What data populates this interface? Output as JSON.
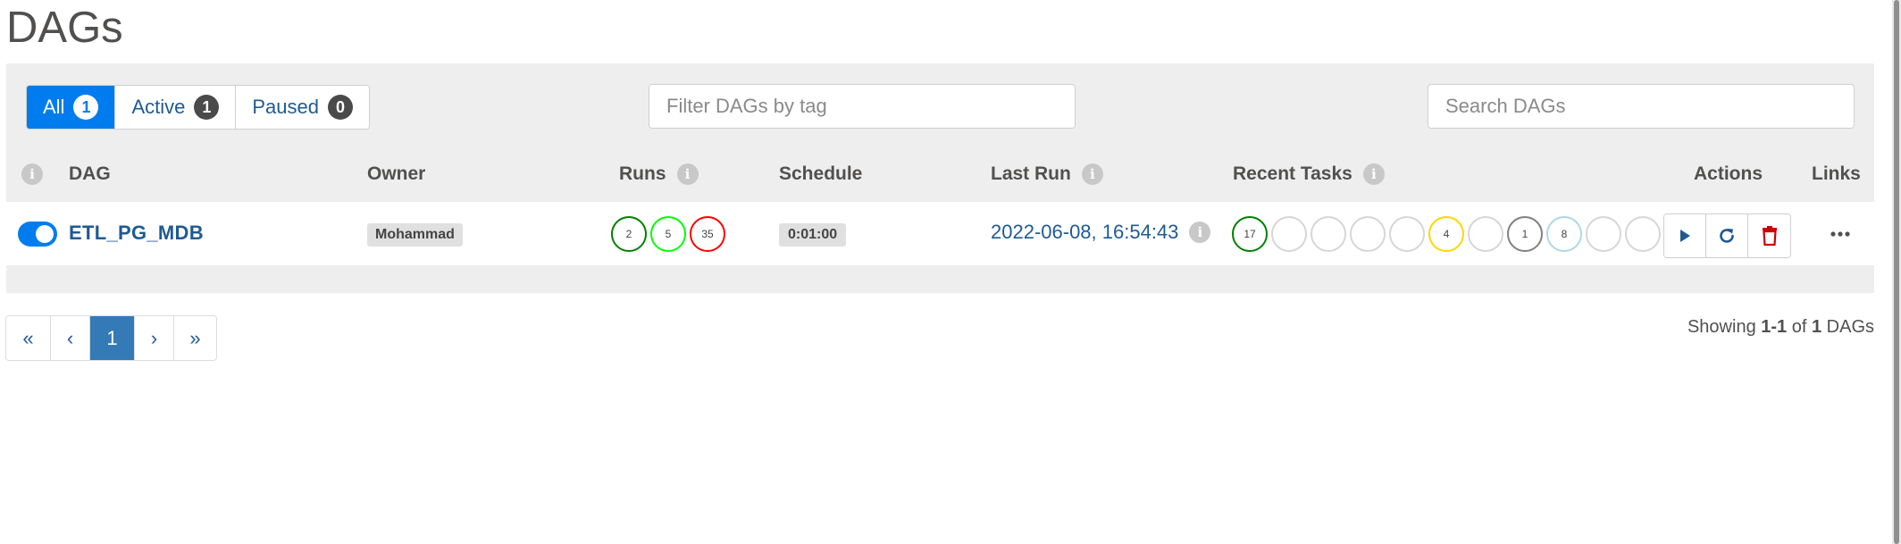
{
  "page": {
    "title": "DAGs"
  },
  "filters": {
    "tabs": [
      {
        "label": "All",
        "count": "1",
        "active": true
      },
      {
        "label": "Active",
        "count": "1",
        "active": false
      },
      {
        "label": "Paused",
        "count": "0",
        "active": false
      }
    ],
    "tag_placeholder": "Filter DAGs by tag",
    "search_placeholder": "Search DAGs"
  },
  "table": {
    "headers": {
      "dag": "DAG",
      "owner": "Owner",
      "runs": "Runs",
      "schedule": "Schedule",
      "last_run": "Last Run",
      "recent_tasks": "Recent Tasks",
      "actions": "Actions",
      "links": "Links"
    },
    "info_icon": "i",
    "rows": [
      {
        "enabled": true,
        "dag_id": "ETL_PG_MDB",
        "owner": "Mohammad",
        "runs": [
          {
            "state": "success",
            "count": "2",
            "color": "#008000"
          },
          {
            "state": "running",
            "count": "5",
            "color": "#00ff00"
          },
          {
            "state": "failed",
            "count": "35",
            "color": "#ff0000"
          }
        ],
        "schedule": "0:01:00",
        "last_run": "2022-06-08, 16:54:43",
        "recent_tasks": [
          {
            "count": "17",
            "color": "#008000"
          },
          {
            "count": "",
            "color": "#d6d6d6"
          },
          {
            "count": "",
            "color": "#d6d6d6"
          },
          {
            "count": "",
            "color": "#d6d6d6"
          },
          {
            "count": "",
            "color": "#d6d6d6"
          },
          {
            "count": "4",
            "color": "#ffd700"
          },
          {
            "count": "",
            "color": "#d6d6d6"
          },
          {
            "count": "1",
            "color": "#808080"
          },
          {
            "count": "8",
            "color": "#add8e6"
          },
          {
            "count": "",
            "color": "#d6d6d6"
          },
          {
            "count": "",
            "color": "#d6d6d6"
          }
        ],
        "actions": [
          {
            "name": "trigger-dag-button",
            "icon": "play-icon"
          },
          {
            "name": "refresh-dag-button",
            "icon": "refresh-icon"
          },
          {
            "name": "delete-dag-button",
            "icon": "trash-icon"
          }
        ],
        "links_icon": "more-icon"
      }
    ]
  },
  "pagination": {
    "first": "«",
    "prev": "‹",
    "current": "1",
    "next": "›",
    "last": "»"
  },
  "footer": {
    "showing_prefix": "Showing",
    "range": "1-1",
    "of": "of",
    "total": "1",
    "suffix": "DAGs"
  },
  "colors": {
    "accent": "#017cee",
    "link": "#1f5a93",
    "danger": "#cc0000",
    "pager_active": "#337ab7"
  }
}
